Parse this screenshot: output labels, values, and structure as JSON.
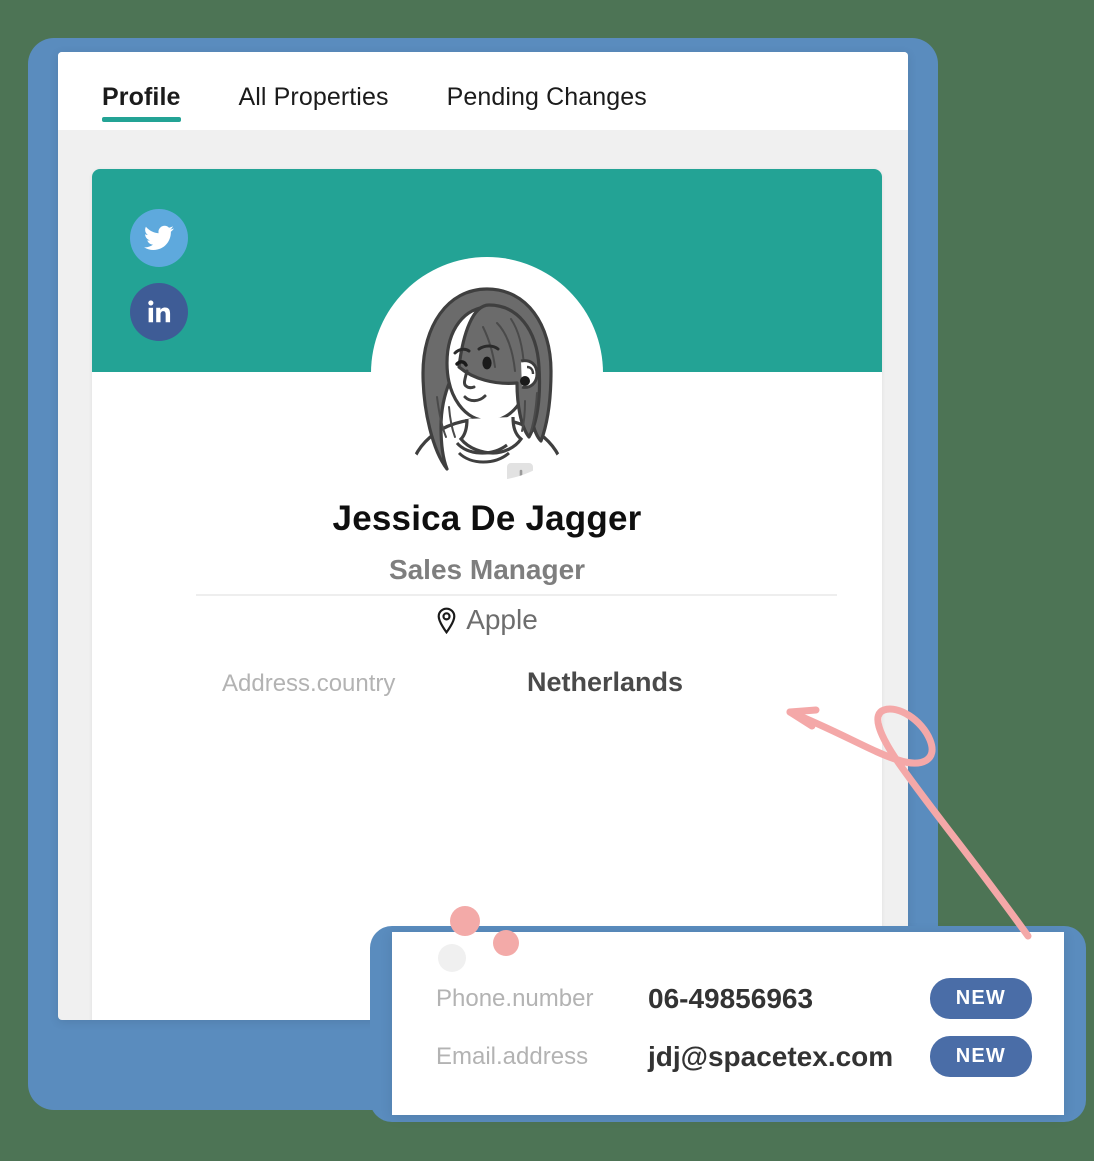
{
  "theme": {
    "page_background": "#4d7455",
    "frame_blue": "#5a8cbe",
    "banner_teal": "#23a395",
    "accent_teal": "#23a395",
    "badge_blue": "#4a6da7",
    "twitter_blue": "#5ea9dd",
    "linkedin_blue": "#3e5c96",
    "annotation_pink": "#f4a8a8",
    "dot_pink": "#f3aaa8",
    "dot_gray": "#f0f0f0"
  },
  "tabs": [
    {
      "label": "Profile",
      "active": true
    },
    {
      "label": "All Properties",
      "active": false
    },
    {
      "label": "Pending Changes",
      "active": false
    }
  ],
  "profile": {
    "name": "Jessica De Jagger",
    "role": "Sales Manager",
    "company": "Apple",
    "company_icon": "map-pin-icon",
    "avatar_alt": "illustration-woman-portrait",
    "socials": [
      {
        "name": "twitter-icon",
        "label": "Twitter"
      },
      {
        "name": "linkedin-icon",
        "label": "LinkedIn"
      }
    ],
    "fields": [
      {
        "key": "Address.country",
        "value": "Netherlands"
      }
    ]
  },
  "overlay": {
    "rows": [
      {
        "key": "Phone.number",
        "value": "06-49856963",
        "badge": "NEW"
      },
      {
        "key": "Email.address",
        "value": "jdj@spacetex.com",
        "badge": "NEW"
      }
    ]
  },
  "annotation": {
    "type": "hand-drawn-arrow-with-loop",
    "points_to": "Netherlands"
  }
}
